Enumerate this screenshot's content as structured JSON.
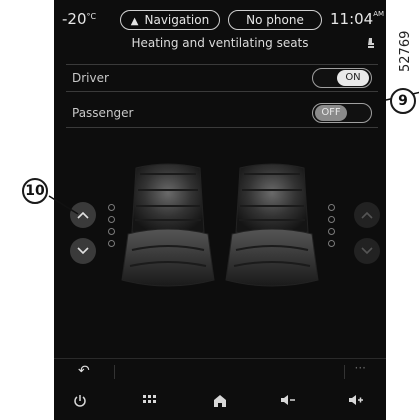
{
  "status": {
    "temperature": "-20",
    "temperature_unit": "°C",
    "navigation_label": "Navigation",
    "phone_label": "No phone",
    "time": "11:04",
    "time_suffix": "AM"
  },
  "page": {
    "title": "Heating and ventilating seats"
  },
  "seats": {
    "driver": {
      "label": "Driver",
      "toggle": "ON",
      "enabled": true
    },
    "passenger": {
      "label": "Passenger",
      "toggle": "OFF",
      "enabled": false
    }
  },
  "callouts": {
    "toggle": "9",
    "arrows": "10"
  },
  "figure_code": "52769",
  "levels": {
    "driver": 0,
    "passenger": 0,
    "max": 3
  },
  "dock": {
    "items": [
      "power-icon",
      "apps-icon",
      "home-icon",
      "volume-down-icon",
      "volume-up-icon"
    ]
  },
  "colors": {
    "background": "#0d0d0d",
    "toggle_on": "#e9e9e9",
    "toggle_off": "#8a8a8a"
  }
}
